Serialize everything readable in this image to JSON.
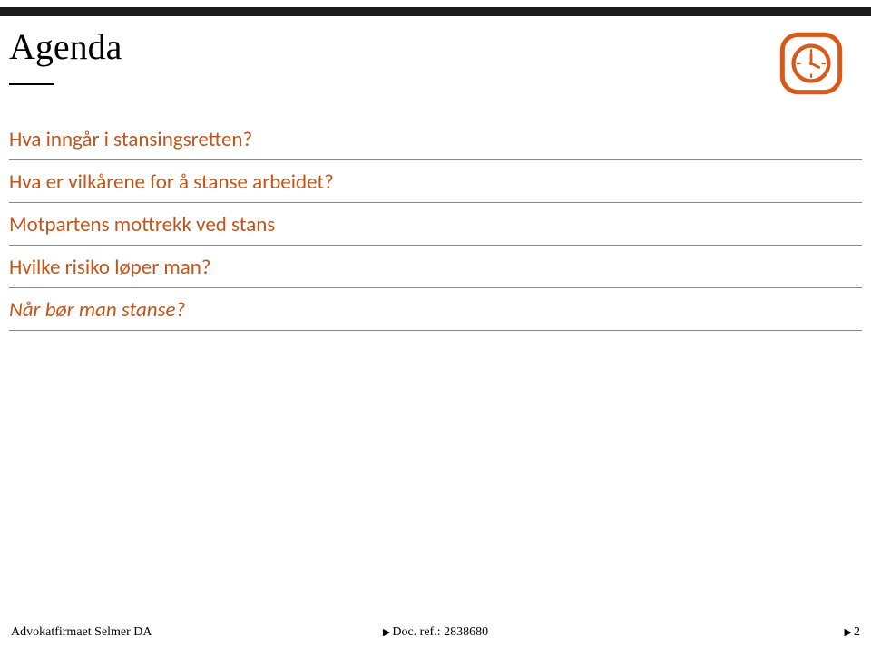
{
  "title": "Agenda",
  "agenda": {
    "items": [
      {
        "text": "Hva inngår i stansingsretten?",
        "italic": false
      },
      {
        "text": "Hva er vilkårene for å stanse arbeidet?",
        "italic": false
      },
      {
        "text": "Motpartens mottrekk ved stans",
        "italic": false
      },
      {
        "text": "Hvilke risiko løper man?",
        "italic": false
      },
      {
        "text": "Når bør man stanse?",
        "italic": true
      }
    ]
  },
  "footer": {
    "left": "Advokatfirmaet Selmer DA",
    "center": "Doc. ref.: 2838680",
    "right": "2"
  },
  "colors": {
    "accent_orange": "#d85a1a",
    "text_orange": "#c1551b"
  }
}
